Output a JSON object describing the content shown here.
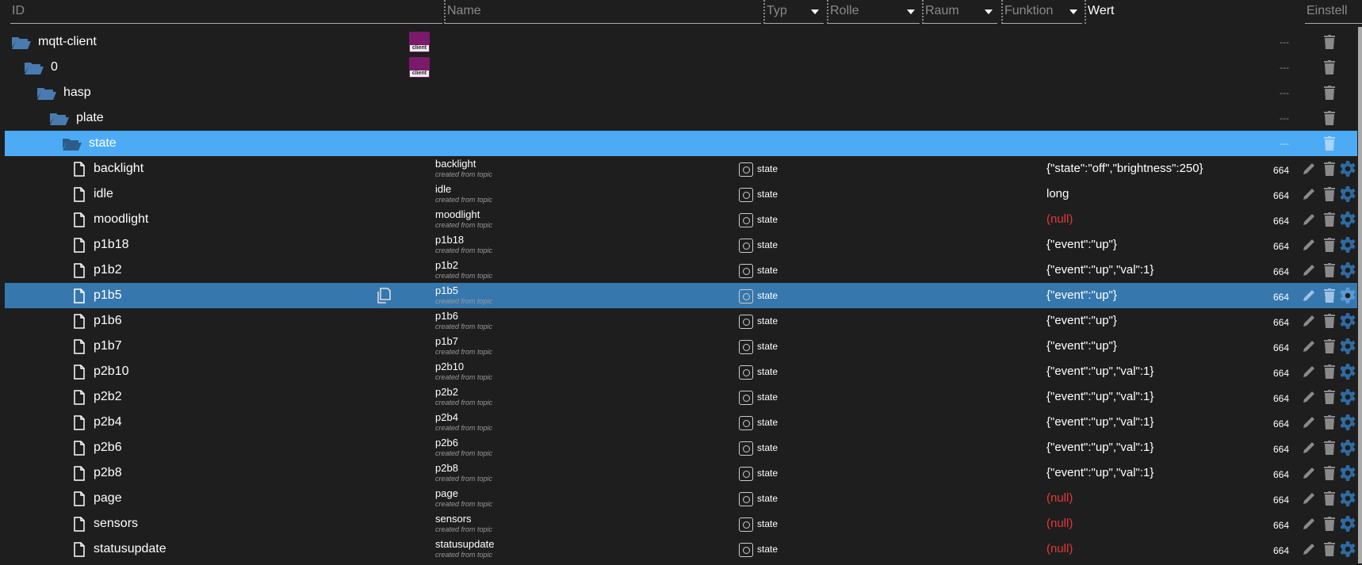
{
  "header": {
    "id": "ID",
    "name": "Name",
    "type": "Typ",
    "role": "Rolle",
    "room": "Raum",
    "function": "Funktion",
    "value": "Wert",
    "settings": "Einstell"
  },
  "colors": {
    "selected": "#4dabf5",
    "selected_dark": "#3677ad",
    "folder": "#4a7bb0",
    "null": "#e53935",
    "gear": "#2f6aa0"
  },
  "tree": [
    {
      "id": "mqtt-client",
      "level": 0,
      "type": "folder",
      "icon": "client",
      "dash": "---"
    },
    {
      "id": "0",
      "level": 1,
      "type": "folder",
      "icon": "client",
      "dash": "---"
    },
    {
      "id": "hasp",
      "level": 2,
      "type": "folder",
      "dash": "---"
    },
    {
      "id": "plate",
      "level": 3,
      "type": "folder",
      "dash": "---"
    },
    {
      "id": "state",
      "level": 4,
      "type": "folder",
      "dash": "---",
      "selected": true
    }
  ],
  "states": [
    {
      "id": "backlight",
      "name": "backlight",
      "note": "created from topic",
      "role": "state",
      "value": "{\"state\":\"off\",\"brightness\":250}",
      "ack": "664"
    },
    {
      "id": "idle",
      "name": "idle",
      "note": "created from topic",
      "role": "state",
      "value": "long",
      "ack": "664"
    },
    {
      "id": "moodlight",
      "name": "moodlight",
      "note": "created from topic",
      "role": "state",
      "value": "(null)",
      "ack": "664"
    },
    {
      "id": "p1b18",
      "name": "p1b18",
      "note": "created from topic",
      "role": "state",
      "value": "{\"event\":\"up\"}",
      "ack": "664"
    },
    {
      "id": "p1b2",
      "name": "p1b2",
      "note": "created from topic",
      "role": "state",
      "value": "{\"event\":\"up\",\"val\":1}",
      "ack": "664"
    },
    {
      "id": "p1b5",
      "name": "p1b5",
      "note": "created from topic",
      "role": "state",
      "value": "{\"event\":\"up\"}",
      "ack": "664",
      "hover": true
    },
    {
      "id": "p1b6",
      "name": "p1b6",
      "note": "created from topic",
      "role": "state",
      "value": "{\"event\":\"up\"}",
      "ack": "664"
    },
    {
      "id": "p1b7",
      "name": "p1b7",
      "note": "created from topic",
      "role": "state",
      "value": "{\"event\":\"up\"}",
      "ack": "664"
    },
    {
      "id": "p2b10",
      "name": "p2b10",
      "note": "created from topic",
      "role": "state",
      "value": "{\"event\":\"up\",\"val\":1}",
      "ack": "664"
    },
    {
      "id": "p2b2",
      "name": "p2b2",
      "note": "created from topic",
      "role": "state",
      "value": "{\"event\":\"up\",\"val\":1}",
      "ack": "664"
    },
    {
      "id": "p2b4",
      "name": "p2b4",
      "note": "created from topic",
      "role": "state",
      "value": "{\"event\":\"up\",\"val\":1}",
      "ack": "664"
    },
    {
      "id": "p2b6",
      "name": "p2b6",
      "note": "created from topic",
      "role": "state",
      "value": "{\"event\":\"up\",\"val\":1}",
      "ack": "664"
    },
    {
      "id": "p2b8",
      "name": "p2b8",
      "note": "created from topic",
      "role": "state",
      "value": "{\"event\":\"up\",\"val\":1}",
      "ack": "664"
    },
    {
      "id": "page",
      "name": "page",
      "note": "created from topic",
      "role": "state",
      "value": "(null)",
      "ack": "664"
    },
    {
      "id": "sensors",
      "name": "sensors",
      "note": "created from topic",
      "role": "state",
      "value": "(null)",
      "ack": "664"
    },
    {
      "id": "statusupdate",
      "name": "statusupdate",
      "note": "created from topic",
      "role": "state",
      "value": "(null)",
      "ack": "664"
    }
  ],
  "client_icon_text": "client"
}
